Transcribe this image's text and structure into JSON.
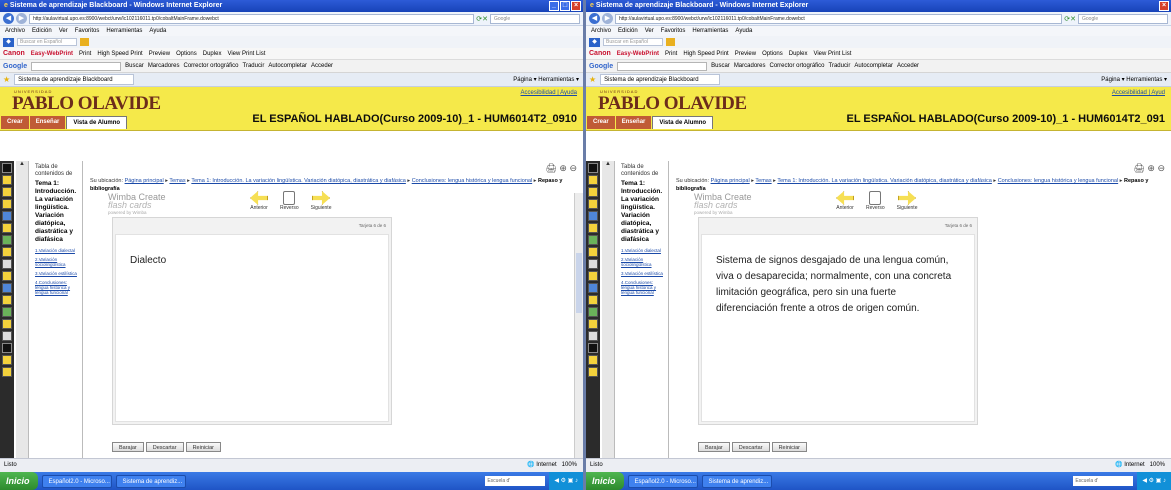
{
  "window": {
    "title": "Sistema de aprendizaje Blackboard - Windows Internet Explorer",
    "url": "http://aulavirtual.upo.es:8900/webct/urw/lc102116011.tp0/cobaltMainFrame.dowebct",
    "search_placeholder": "Google"
  },
  "menubar": [
    "Archivo",
    "Edición",
    "Ver",
    "Favoritos",
    "Herramientas",
    "Ayuda"
  ],
  "live_search": {
    "placeholder": "Buscar en Español"
  },
  "easy_toolbar": {
    "brand": "Canon",
    "product": "Easy-WebPrint",
    "items": [
      "Print",
      "High Speed Print",
      "Preview",
      "Options",
      "Duplex",
      "View Print List"
    ]
  },
  "google_toolbar": {
    "logo": "Google",
    "items": [
      "Buscar",
      "Marcadores",
      "Corrector ortográfico",
      "Traducir",
      "Autocompletar"
    ],
    "right": "Acceder"
  },
  "tabbar": {
    "tab_title": "Sistema de aprendizaje Blackboard",
    "tools": "Página ▾  Herramientas ▾"
  },
  "header": {
    "logo_sub": "UNIVERSIDAD",
    "logo": "PABLO OLAVIDE",
    "access_link": "Accesibilidad | Ayuda",
    "access_link_right": "Accesibilidad | Ayud",
    "course_title": "EL ESPAÑOL HABLADO(Curso 2009-10)_1 - HUM6014T2_0910",
    "course_title_right": "EL ESPAÑOL HABLADO(Curso 2009-10)_1 - HUM6014T2_091",
    "mode_buttons": [
      "Crear",
      "Enseñar",
      "Vista de Alumno"
    ]
  },
  "toc": {
    "title": "Tabla de contenidos de",
    "section": "Tema 1: Introducción. La variación lingüística. Variación diatópica, diastrática y diafásica",
    "links": [
      "1.Variación dialectal",
      "2.Variación sociolingüística",
      "3.Variación estilística",
      "4.Conclusiones: lengua histórica y lengua funcional"
    ]
  },
  "breadcrumb": {
    "prefix": "Su ubicación:",
    "links": [
      "Página principal",
      "Temas",
      "Tema 1: Introducción. La variación lingüística. Variación diatópica, diastrática y diafásica",
      "Conclusiones: lengua histórica y lengua funcional"
    ],
    "current": "Repaso y bibliografía"
  },
  "flashcards": {
    "logo_line1": "Wimba Create",
    "logo_line2": "flash cards",
    "logo_line3": "powered by Wimba",
    "prev_label": "Anterior",
    "flip_label": "Reverso",
    "next_label": "Siguiente",
    "counter": "Tarjeta 6 de 6",
    "left_card_text": "Dialecto",
    "right_card_text": "Sistema de signos desgajado de una lengua común, viva o desaparecida; normalmente, con una concreta limitación geográfica, pero sin una fuerte diferenciación frente a otros de origen común.",
    "buttons": [
      "Barajar",
      "Descartar",
      "Reiniciar"
    ]
  },
  "statusbar": {
    "left": "Listo",
    "zone": "Internet",
    "zoom": "100%"
  },
  "taskbar": {
    "start": "Inicio",
    "items": [
      "Español2.0 - Microso...",
      "Sistema de aprendiz..."
    ],
    "search_placeholder": "Escuela d'"
  },
  "colors": {
    "header_yellow": "#f5e94a",
    "logo_maroon": "#6c2c1b",
    "link_blue": "#1b4aa8",
    "mode_button": "#c05b36"
  }
}
